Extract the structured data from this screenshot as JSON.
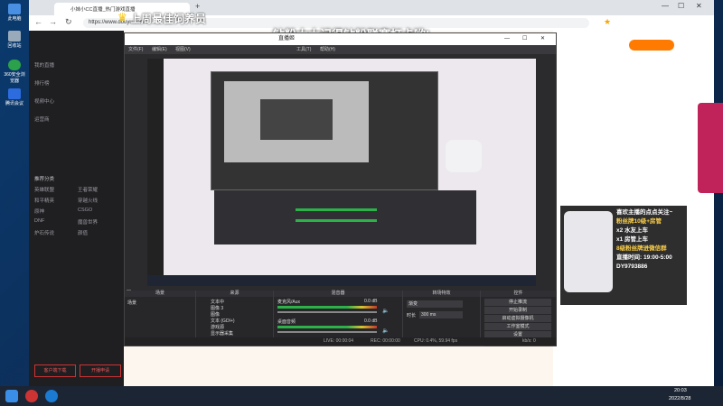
{
  "desktop": {
    "icons": [
      "此电脑",
      "回收站",
      "360安全浏览器",
      "腾讯会议"
    ]
  },
  "browser": {
    "tab_title": "小妹小CC直播_热门游戏直播",
    "url": "https://www.douyu.com/",
    "title_banner": "上周最佳饲养员",
    "scrolling_text": "钻粉大大记得钻粉联赛打卡哟!"
  },
  "left_nav": {
    "top_items": [
      "我的直播",
      "排行榜",
      "视频中心",
      "运营商"
    ],
    "section_label": "推荐分类",
    "categories": [
      "英雄联盟",
      "王者荣耀",
      "和平精英",
      "穿越火线",
      "原神",
      "CSGO",
      "DNF",
      "魔兽世界",
      "炉石传说",
      "颜值"
    ],
    "bottom_buttons": [
      "客户端下载",
      "开播申请"
    ]
  },
  "obs": {
    "window_title": "直播姬",
    "menu": [
      "文件(F)",
      "编辑(E)",
      "视图(V)",
      "工具(T)",
      "帮助(H)"
    ],
    "scenes_label": "场景",
    "scene_item": "场景",
    "sources_label": "来源",
    "sources": [
      "文本中",
      "图像 3",
      "图像",
      "文本 (GDI+)",
      "游戏源",
      "显示器采集"
    ],
    "mixer_label": "混音器",
    "mixer_tracks": [
      {
        "name": "麦克风/Aux",
        "level": "0.0 dB"
      },
      {
        "name": "桌面音频",
        "level": "0.0 dB"
      }
    ],
    "transitions_label": "转场特效",
    "transition_value": "渐变",
    "duration_label": "时长",
    "duration_value": "300 ms",
    "controls_label": "控件",
    "controls": [
      "停止推流",
      "开始录制",
      "启动虚拟摄像机",
      "工作室模式",
      "设置",
      "退出"
    ],
    "status": {
      "live": "LIVE: 00:00:04",
      "rec": "REC: 00:00:00",
      "cpu": "CPU: 0.4%, 59.94 fps",
      "kbps": "kb/s: 0"
    }
  },
  "stream_overlay": {
    "lines": [
      "喜欢主播的点点关注~",
      "粉丝牌10级+房管",
      "x2 水友上车",
      "x1 房管上车",
      "8级粉丝牌进微信群",
      "直播时间: 19:00-5:00",
      "DY9793886"
    ]
  },
  "taskbar": {
    "time": "20:03",
    "date": "2022/8/28"
  },
  "colors": {
    "accent_orange": "#ff7a00",
    "obs_bg": "#2b2b2e",
    "overlay_bg": "#000000"
  }
}
